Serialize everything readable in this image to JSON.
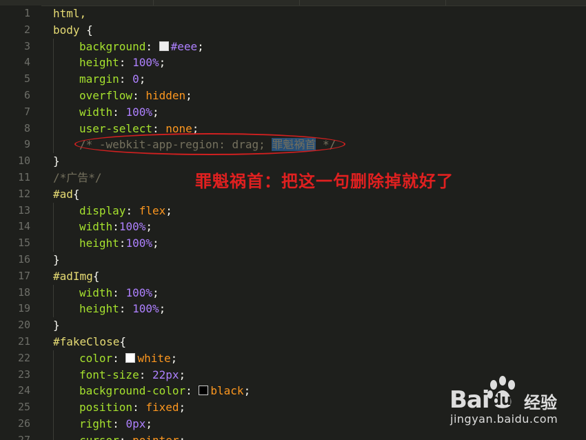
{
  "lines": [
    {
      "n": "1",
      "indent": 0,
      "tokens": [
        {
          "t": "html,",
          "c": "sel"
        }
      ]
    },
    {
      "n": "2",
      "indent": 0,
      "tokens": [
        {
          "t": "body",
          "c": "sel"
        },
        {
          "t": " {",
          "c": "punc"
        }
      ]
    },
    {
      "n": "3",
      "indent": 1,
      "tokens": [
        {
          "t": "background",
          "c": "prop"
        },
        {
          "t": ": ",
          "c": "punc"
        },
        {
          "sw": "#eeeeee"
        },
        {
          "t": "#eee",
          "c": "hex"
        },
        {
          "t": ";",
          "c": "punc"
        }
      ]
    },
    {
      "n": "4",
      "indent": 1,
      "tokens": [
        {
          "t": "height",
          "c": "prop"
        },
        {
          "t": ": ",
          "c": "punc"
        },
        {
          "t": "100%",
          "c": "num"
        },
        {
          "t": ";",
          "c": "punc"
        }
      ]
    },
    {
      "n": "5",
      "indent": 1,
      "tokens": [
        {
          "t": "margin",
          "c": "prop"
        },
        {
          "t": ": ",
          "c": "punc"
        },
        {
          "t": "0",
          "c": "num"
        },
        {
          "t": ";",
          "c": "punc"
        }
      ]
    },
    {
      "n": "6",
      "indent": 1,
      "tokens": [
        {
          "t": "overflow",
          "c": "prop"
        },
        {
          "t": ": ",
          "c": "punc"
        },
        {
          "t": "hidden",
          "c": "val-kw"
        },
        {
          "t": ";",
          "c": "punc"
        }
      ]
    },
    {
      "n": "7",
      "indent": 1,
      "tokens": [
        {
          "t": "width",
          "c": "prop"
        },
        {
          "t": ": ",
          "c": "punc"
        },
        {
          "t": "100%",
          "c": "num"
        },
        {
          "t": ";",
          "c": "punc"
        }
      ]
    },
    {
      "n": "8",
      "indent": 1,
      "tokens": [
        {
          "t": "user-select",
          "c": "prop"
        },
        {
          "t": ": ",
          "c": "punc"
        },
        {
          "t": "none",
          "c": "val-kw"
        },
        {
          "t": ";",
          "c": "punc"
        }
      ]
    },
    {
      "n": "9",
      "indent": 1,
      "tokens": [
        {
          "t": "/* -webkit-app-region: drag; ",
          "c": "cmt"
        },
        {
          "t": "罪魁祸首",
          "c": "hl"
        },
        {
          "t": " */",
          "c": "cmt"
        }
      ]
    },
    {
      "n": "10",
      "indent": 0,
      "tokens": [
        {
          "t": "}",
          "c": "punc"
        }
      ]
    },
    {
      "n": "11",
      "indent": 0,
      "tokens": [
        {
          "t": "/*广告*/",
          "c": "cmt"
        }
      ]
    },
    {
      "n": "12",
      "indent": 0,
      "tokens": [
        {
          "t": "#ad",
          "c": "sel"
        },
        {
          "t": "{",
          "c": "punc"
        }
      ]
    },
    {
      "n": "13",
      "indent": 1,
      "tokens": [
        {
          "t": "display",
          "c": "prop"
        },
        {
          "t": ": ",
          "c": "punc"
        },
        {
          "t": "flex",
          "c": "val-kw"
        },
        {
          "t": ";",
          "c": "punc"
        }
      ]
    },
    {
      "n": "14",
      "indent": 1,
      "tokens": [
        {
          "t": "width",
          "c": "prop"
        },
        {
          "t": ":",
          "c": "punc"
        },
        {
          "t": "100%",
          "c": "num"
        },
        {
          "t": ";",
          "c": "punc"
        }
      ]
    },
    {
      "n": "15",
      "indent": 1,
      "tokens": [
        {
          "t": "height",
          "c": "prop"
        },
        {
          "t": ":",
          "c": "punc"
        },
        {
          "t": "100%",
          "c": "num"
        },
        {
          "t": ";",
          "c": "punc"
        }
      ]
    },
    {
      "n": "16",
      "indent": 0,
      "tokens": [
        {
          "t": "}",
          "c": "punc"
        }
      ]
    },
    {
      "n": "17",
      "indent": 0,
      "tokens": [
        {
          "t": "#adImg",
          "c": "sel"
        },
        {
          "t": "{",
          "c": "punc"
        }
      ]
    },
    {
      "n": "18",
      "indent": 1,
      "tokens": [
        {
          "t": "width",
          "c": "prop"
        },
        {
          "t": ": ",
          "c": "punc"
        },
        {
          "t": "100%",
          "c": "num"
        },
        {
          "t": ";",
          "c": "punc"
        }
      ]
    },
    {
      "n": "19",
      "indent": 1,
      "tokens": [
        {
          "t": "height",
          "c": "prop"
        },
        {
          "t": ": ",
          "c": "punc"
        },
        {
          "t": "100%",
          "c": "num"
        },
        {
          "t": ";",
          "c": "punc"
        }
      ]
    },
    {
      "n": "20",
      "indent": 0,
      "tokens": [
        {
          "t": "}",
          "c": "punc"
        }
      ]
    },
    {
      "n": "21",
      "indent": 0,
      "tokens": [
        {
          "t": "#fakeClose",
          "c": "sel"
        },
        {
          "t": "{",
          "c": "punc"
        }
      ]
    },
    {
      "n": "22",
      "indent": 1,
      "tokens": [
        {
          "t": "color",
          "c": "prop"
        },
        {
          "t": ": ",
          "c": "punc"
        },
        {
          "sw": "#ffffff"
        },
        {
          "t": "white",
          "c": "val-kw"
        },
        {
          "t": ";",
          "c": "punc"
        }
      ]
    },
    {
      "n": "23",
      "indent": 1,
      "tokens": [
        {
          "t": "font-size",
          "c": "prop"
        },
        {
          "t": ": ",
          "c": "punc"
        },
        {
          "t": "22px",
          "c": "num"
        },
        {
          "t": ";",
          "c": "punc"
        }
      ]
    },
    {
      "n": "24",
      "indent": 1,
      "tokens": [
        {
          "t": "background-color",
          "c": "prop"
        },
        {
          "t": ": ",
          "c": "punc"
        },
        {
          "sw": "#000000"
        },
        {
          "t": "black",
          "c": "val-kw"
        },
        {
          "t": ";",
          "c": "punc"
        }
      ]
    },
    {
      "n": "25",
      "indent": 1,
      "tokens": [
        {
          "t": "position",
          "c": "prop"
        },
        {
          "t": ": ",
          "c": "punc"
        },
        {
          "t": "fixed",
          "c": "val-kw"
        },
        {
          "t": ";",
          "c": "punc"
        }
      ]
    },
    {
      "n": "26",
      "indent": 1,
      "tokens": [
        {
          "t": "right",
          "c": "prop"
        },
        {
          "t": ": ",
          "c": "punc"
        },
        {
          "t": "0px",
          "c": "num"
        },
        {
          "t": ";",
          "c": "punc"
        }
      ]
    },
    {
      "n": "27",
      "indent": 1,
      "tokens": [
        {
          "t": "cursor",
          "c": "prop"
        },
        {
          "t": ": ",
          "c": "punc"
        },
        {
          "t": "pointer",
          "c": "val-kw"
        },
        {
          "t": ";",
          "c": "punc"
        }
      ]
    }
  ],
  "annotation": {
    "text": "罪魁祸首：把这一句删除掉就好了"
  },
  "watermark": {
    "brand": "Bai",
    "brand_tail": "du",
    "brand_cn": "经验",
    "url": "jingyan.baidu.com"
  },
  "colors": {
    "annotation": "#e02020",
    "highlight": "#264f78"
  }
}
